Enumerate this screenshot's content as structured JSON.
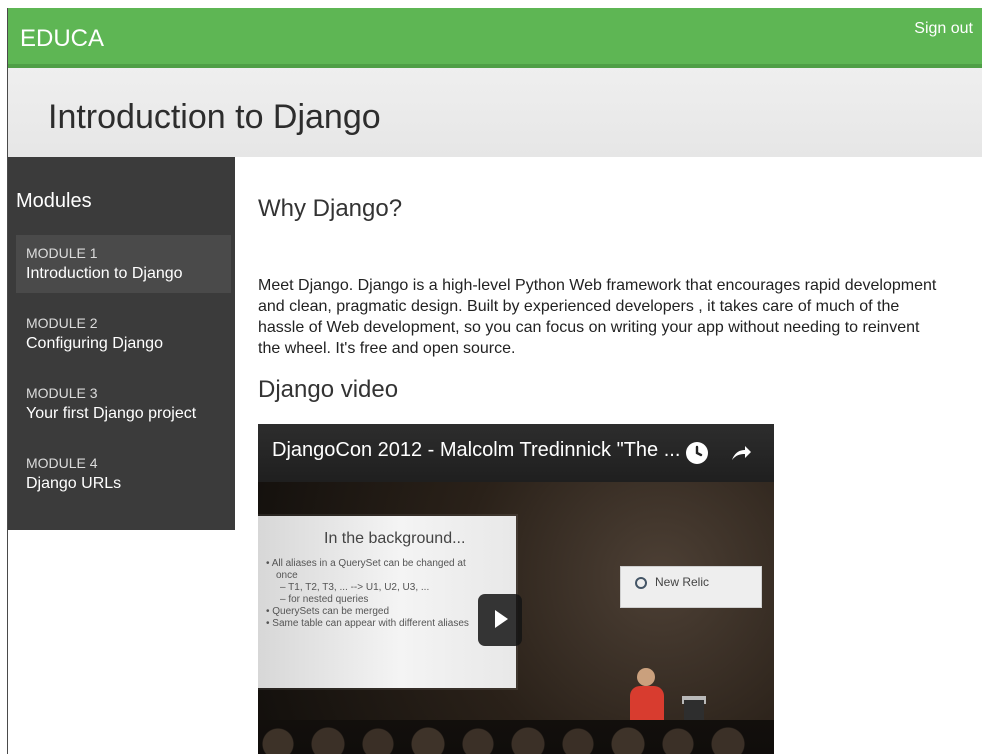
{
  "header": {
    "brand": "EDUCA",
    "sign_out": "Sign out"
  },
  "course": {
    "title": "Introduction to Django"
  },
  "sidebar": {
    "title": "Modules",
    "modules": [
      {
        "label": "MODULE 1",
        "name": "Introduction to Django",
        "active": true
      },
      {
        "label": "MODULE 2",
        "name": "Configuring Django",
        "active": false
      },
      {
        "label": "MODULE 3",
        "name": "Your first Django project",
        "active": false
      },
      {
        "label": "MODULE 4",
        "name": "Django URLs",
        "active": false
      }
    ]
  },
  "content": {
    "section1_title": "Why Django?",
    "section1_text": "Meet Django. Django is a high-level Python Web framework that encourages rapid development and clean, pragmatic design. Built by experienced developers , it takes care of much of the hassle of Web development, so you can focus on writing your app without needing to reinvent the wheel. It's free and open source.",
    "section2_title": "Django video"
  },
  "video": {
    "title": "DjangoCon 2012 - Malcolm Tredinnick \"The ...",
    "slide_title": "In the background...",
    "slide_lines": [
      "• All aliases in a QuerySet can be changed at",
      "once",
      "– T1, T2, T3, ... --> U1, U2, U3, ...",
      "– for nested queries",
      "• QuerySets can be merged",
      "• Same table can appear with different aliases"
    ],
    "banner": "New Relic",
    "icons": {
      "clock": "clock-icon",
      "share": "share-icon",
      "play": "play-icon"
    }
  },
  "colors": {
    "header_green": "#5eb654",
    "sidebar_dark": "#3b3b3b"
  }
}
